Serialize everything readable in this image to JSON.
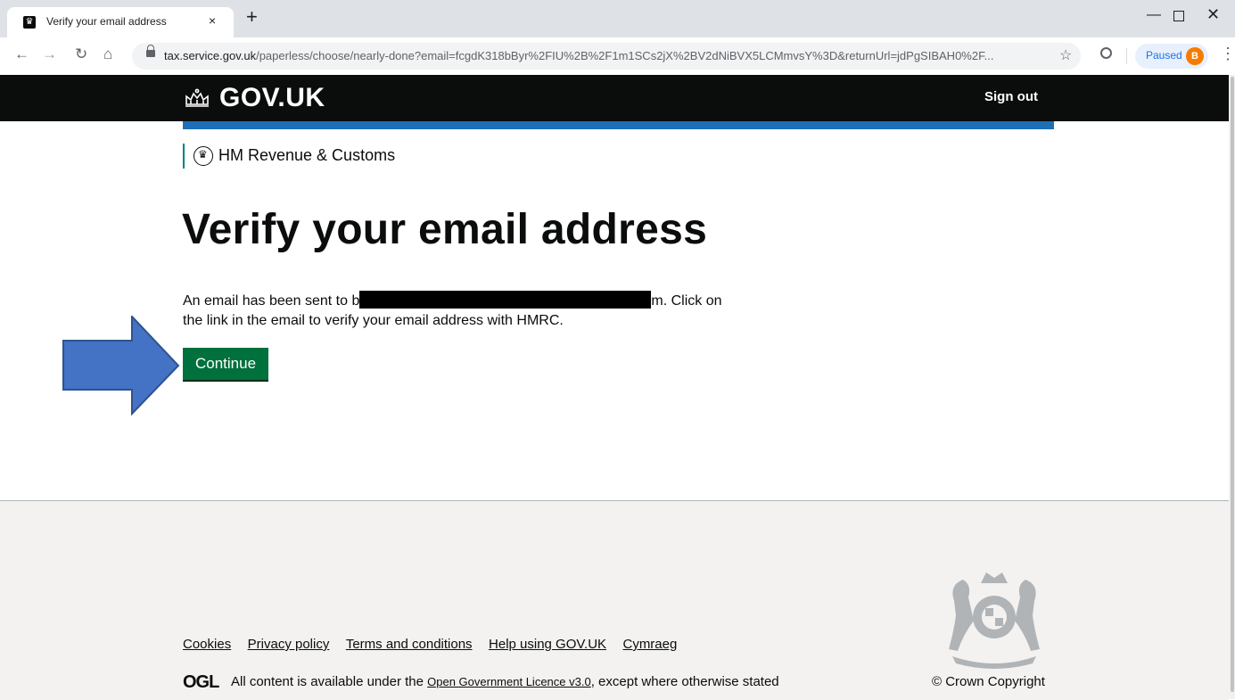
{
  "browser": {
    "tab_title": "Verify your email address",
    "tab_close": "×",
    "new_tab": "+",
    "url_domain": "tax.service.gov.uk",
    "url_path": "/paperless/choose/nearly-done?email=fcgdK318bByr%2FIU%2B%2F1m1SCs2jX%2BV2dNiBVX5LCMmvsY%3D&returnUrl=jdPgSIBAH0%2F...",
    "profile_label": "Paused",
    "avatar_letter": "B"
  },
  "header": {
    "logo_text": "GOV.UK",
    "sign_out": "Sign out"
  },
  "organisation": "HM Revenue & Customs",
  "main": {
    "title": "Verify your email address",
    "text_before": "An email has been sent to b",
    "text_after": "m. Click on the link in the email to verify your email address with HMRC.",
    "continue_label": "Continue"
  },
  "footer": {
    "links": [
      "Cookies",
      "Privacy policy",
      "Terms and conditions",
      "Help using GOV.UK",
      "Cymraeg"
    ],
    "ogl": "OGL",
    "licence_before": "All content is available under the ",
    "licence_link": "Open Government Licence v3.0",
    "licence_after": ", except where otherwise stated",
    "copyright": "© Crown Copyright"
  },
  "colors": {
    "header_bg": "#0b0c0c",
    "brand_blue": "#1d70b8",
    "button_green": "#00703c",
    "org_stripe": "#00837a",
    "annotation_arrow": "#4472c4"
  }
}
